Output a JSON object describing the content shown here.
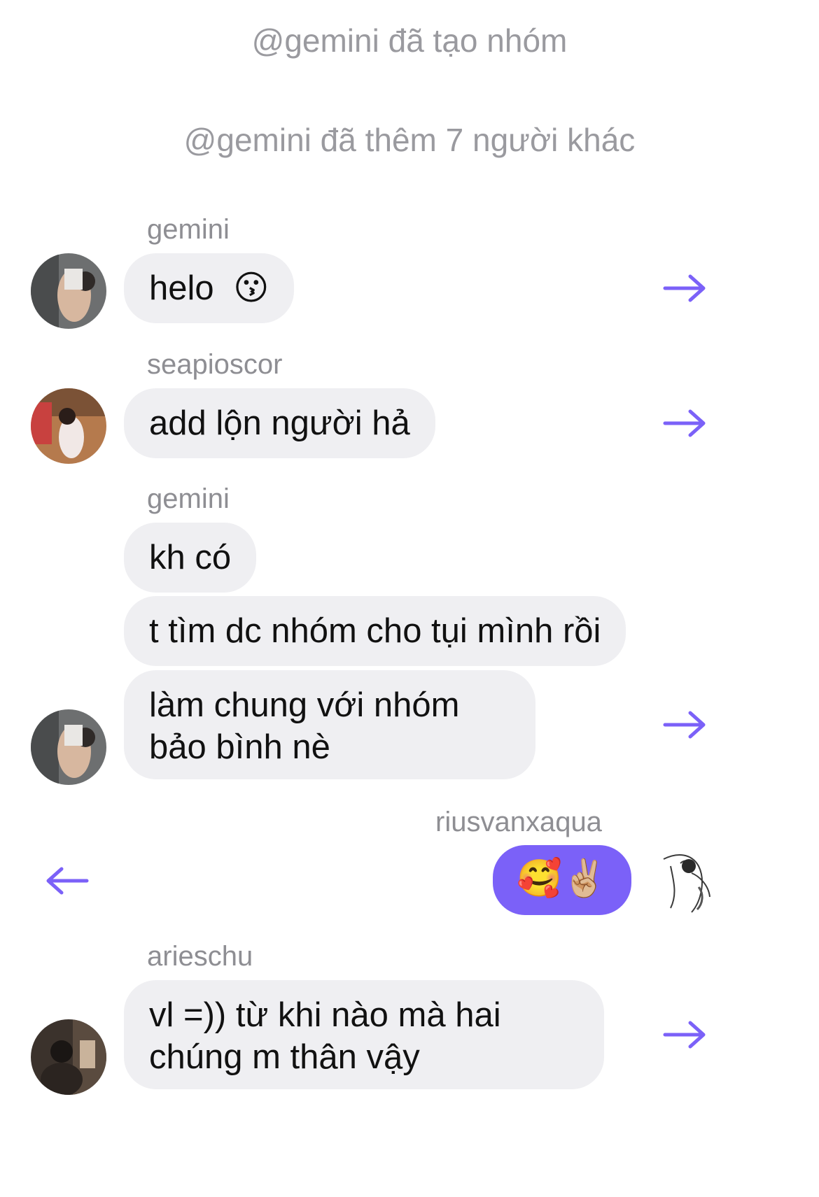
{
  "system_messages": [
    "@gemini đã tạo nhóm",
    "@gemini đã thêm 7 người khác"
  ],
  "colors": {
    "accent": "#7b61f8",
    "bubble_gray": "#efeff2",
    "meta_text": "#8e8e93"
  },
  "messages": [
    {
      "sender": "gemini",
      "text": "helo",
      "emoji": "😗"
    },
    {
      "sender": "seapioscor",
      "text": "add lộn người hả"
    },
    {
      "sender": "gemini",
      "text": "kh có"
    },
    {
      "text": "t tìm dc nhóm cho tụi mình rồi"
    },
    {
      "text": "làm chung với nhóm bảo bình nè"
    },
    {
      "sender": "riusvanxaqua",
      "text": "🥰✌🏼"
    },
    {
      "sender": "arieschu",
      "text": "vl =)) từ khi nào mà hai chúng m thân vậy"
    }
  ],
  "icons": {
    "forward": "arrow-right-icon",
    "reply": "arrow-left-icon"
  }
}
